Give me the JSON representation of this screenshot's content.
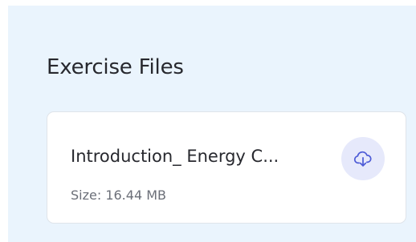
{
  "exercise_files": {
    "title": "Exercise Files",
    "files": [
      {
        "name": "Introduction_ Energy C...",
        "size_label": "Size: 16.44 MB",
        "download_icon": "cloud-download-icon"
      }
    ]
  },
  "colors": {
    "panel_background": "#eaf4fd",
    "card_background": "#ffffff",
    "accent": "#4d5bd6",
    "download_button_background": "#e6e9fb"
  }
}
